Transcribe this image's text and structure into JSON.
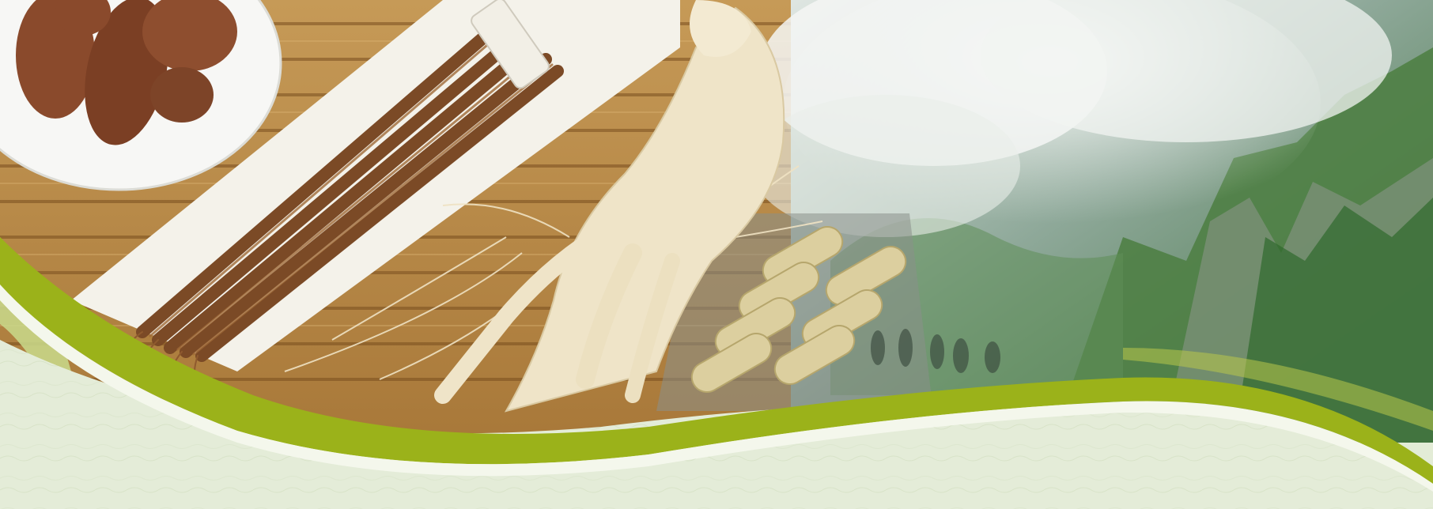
{
  "scene": {
    "description_free": true,
    "elements": [
      "sliced-red-ginseng-plate",
      "bundled-dried-red-ginseng-roots",
      "fresh-white-ginseng-root",
      "capsule-tray",
      "misty-green-mountain",
      "green-swoosh-band",
      "pale-green-textured-footer"
    ]
  },
  "colors": {
    "wood_light": "#b88a48",
    "wood_dark": "#7a4f1f",
    "paper": "#f4f2ea",
    "plate": "#f7f7f5",
    "red_ginseng": "#8a4a2c",
    "dried_root": "#7b4a26",
    "white_root": "#efe4c8",
    "capsule": "#d8cfa4",
    "mist": "#eef1ee",
    "mountain_green": "#3f7a3a",
    "rock_gray": "#8d958c",
    "swoosh_green": "#9bb21a",
    "swoosh_light": "#c9da8c",
    "footer_bg": "#e4ecd8"
  }
}
